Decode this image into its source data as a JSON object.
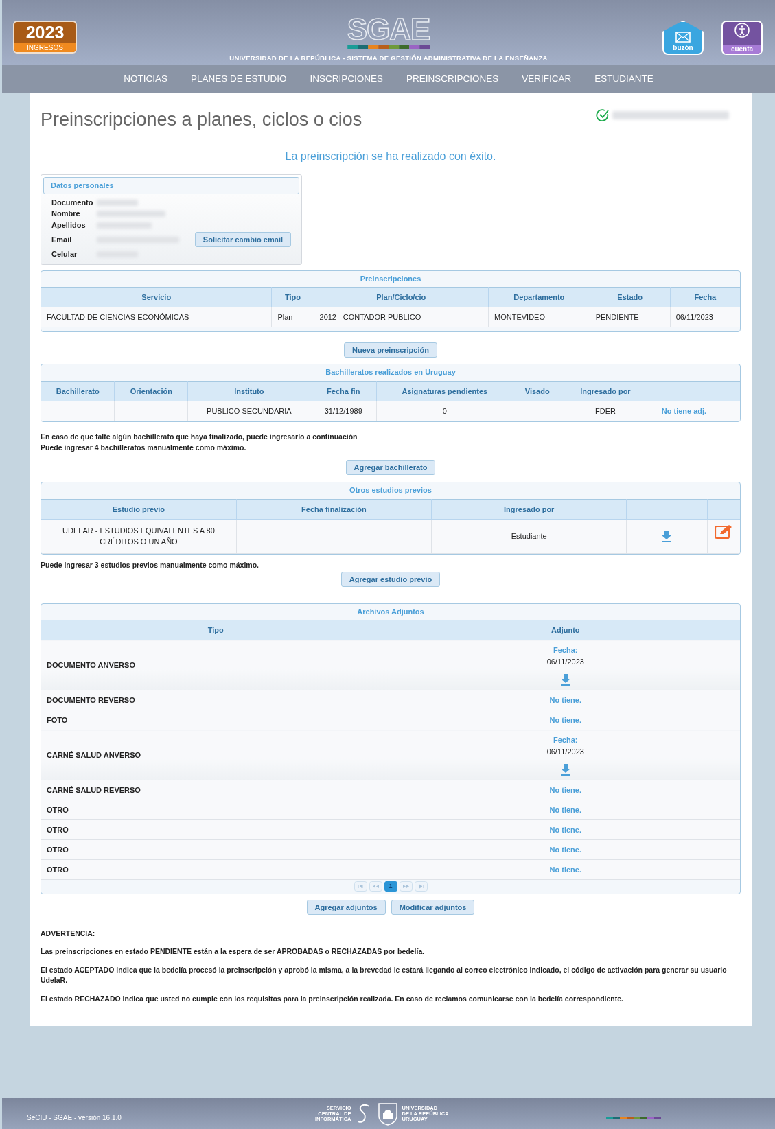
{
  "header": {
    "badge_year": "2023",
    "badge_label": "INGRESOS",
    "brand": "SGAE",
    "tagline": "UNIVERSIDAD DE LA REPÚBLICA - SISTEMA DE GESTIÓN ADMINISTRATIVA DE LA ENSEÑANZA",
    "mailbox_label": "buzón",
    "account_label": "cuenta"
  },
  "nav": [
    "NOTICIAS",
    "PLANES DE ESTUDIO",
    "INSCRIPCIONES",
    "PREINSCRIPCIONES",
    "VERIFICAR",
    "ESTUDIANTE"
  ],
  "page_title": "Preinscripciones a planes, ciclos o cios",
  "success_message": "La preinscripción se ha realizado con éxito.",
  "personal_data": {
    "title": "Datos personales",
    "fields": [
      {
        "label": "Documento"
      },
      {
        "label": "Nombre"
      },
      {
        "label": "Apellidos"
      },
      {
        "label": "Email",
        "action": "Solicitar cambio email"
      },
      {
        "label": "Celular"
      }
    ]
  },
  "preinscripciones": {
    "title": "Preinscripciones",
    "columns": [
      "Servicio",
      "Tipo",
      "Plan/Ciclo/cio",
      "Departamento",
      "Estado",
      "Fecha"
    ],
    "rows": [
      [
        "FACULTAD DE CIENCIAS ECONÓMICAS",
        "Plan",
        "2012 - CONTADOR PUBLICO",
        "MONTEVIDEO",
        "PENDIENTE",
        "06/11/2023"
      ]
    ]
  },
  "new_button": "Nueva preinscripción",
  "bachilleratos": {
    "title": "Bachilleratos realizados en Uruguay",
    "columns": [
      "Bachillerato",
      "Orientación",
      "Instituto",
      "Fecha fin",
      "Asignaturas pendientes",
      "Visado",
      "Ingresado por"
    ],
    "rows": [
      {
        "cells": [
          "---",
          "---",
          "PUBLICO SECUNDARIA",
          "31/12/1989",
          "0",
          "---",
          "FDER"
        ],
        "link": "No tiene adj."
      }
    ]
  },
  "bachillerato_notes": [
    "En caso de que falte algún bachillerato que haya finalizado, puede ingresarlo a continuación",
    "Puede ingresar 4 bachilleratos manualmente como máximo."
  ],
  "add_bachillerato_button": "Agregar bachillerato",
  "otros_estudios": {
    "title": "Otros estudios previos",
    "columns": [
      "Estudio previo",
      "Fecha finalización",
      "Ingresado por"
    ],
    "rows": [
      {
        "cells": [
          "UDELAR - ESTUDIOS EQUIVALENTES A 80 CRÉDITOS O UN AÑO",
          "---",
          "Estudiante"
        ],
        "downloadable": true,
        "editable": true
      }
    ]
  },
  "otros_note": "Puede ingresar 3 estudios previos manualmente como máximo.",
  "add_estudio_button": "Agregar estudio previo",
  "adjuntos": {
    "title": "Archivos Adjuntos",
    "columns": [
      "Tipo",
      "Adjunto"
    ],
    "rows": [
      {
        "tipo": "DOCUMENTO ANVERSO",
        "kind": "file",
        "label": "Fecha:",
        "date": "06/11/2023"
      },
      {
        "tipo": "DOCUMENTO REVERSO",
        "kind": "none",
        "text": "No tiene."
      },
      {
        "tipo": "FOTO",
        "kind": "none",
        "text": "No tiene."
      },
      {
        "tipo": "CARNÉ SALUD ANVERSO",
        "kind": "file",
        "label": "Fecha:",
        "date": "06/11/2023"
      },
      {
        "tipo": "CARNÉ SALUD REVERSO",
        "kind": "none",
        "text": "No tiene."
      },
      {
        "tipo": "OTRO",
        "kind": "none",
        "text": "No tiene."
      },
      {
        "tipo": "OTRO",
        "kind": "none",
        "text": "No tiene."
      },
      {
        "tipo": "OTRO",
        "kind": "none",
        "text": "No tiene."
      },
      {
        "tipo": "OTRO",
        "kind": "none",
        "text": "No tiene."
      }
    ],
    "pages": [
      {
        "label": "1",
        "selected": true
      }
    ]
  },
  "attachment_buttons": [
    "Agregar adjuntos",
    "Modificar adjuntos"
  ],
  "warning_title": "ADVERTENCIA:",
  "warnings": [
    "Las preinscripciones en estado PENDIENTE están a la espera de ser APROBADAS o RECHAZADAS por bedelía.",
    "El estado ACEPTADO indica que la bedelía procesó la preinscripción y aprobó la misma, a la brevedad le estará llegando al correo electrónico indicado, el código de activación para generar su usuario UdelaR.",
    "El estado RECHAZADO indica que usted no cumple con los requisitos para la preinscripción realizada. En caso de reclamos comunicarse con la bedelía correspondiente."
  ],
  "footer": {
    "version": "SeCIU - SGAE - versión 16.1.0",
    "seciu_lines": [
      "SERVICIO",
      "CENTRAL DE",
      "INFORMÁTICA"
    ],
    "udelar_lines": [
      "UNIVERSIDAD",
      "DE LA REPÚBLICA",
      "URUGUAY"
    ]
  }
}
